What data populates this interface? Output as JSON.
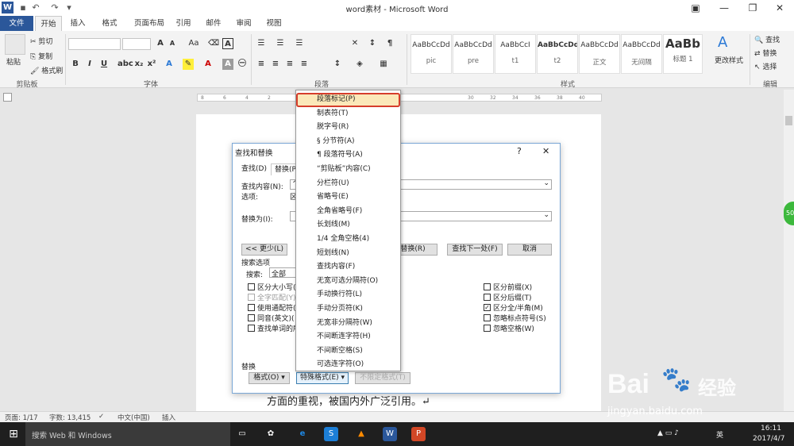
{
  "window": {
    "title": "word素材 - Microsoft Word"
  },
  "tabs": [
    "文件",
    "开始",
    "插入",
    "格式",
    "页面布局",
    "引用",
    "邮件",
    "审阅",
    "视图"
  ],
  "ribbon": {
    "clipboard": {
      "paste": "粘贴",
      "cut": "剪切",
      "copy": "复制",
      "painter": "格式刷",
      "label": "剪贴板"
    },
    "font": {
      "label": "字体",
      "bold": "B",
      "italic": "I",
      "underline": "U",
      "grow": "A",
      "shrink": "A",
      "aa": "Aa"
    },
    "paragraph": {
      "label": "段落"
    },
    "styles": {
      "label": "样式",
      "items": [
        {
          "sample": "AaBbCcDd",
          "name": "pic"
        },
        {
          "sample": "AaBbCcDd",
          "name": "pre"
        },
        {
          "sample": "AaBbCcI",
          "name": "t1"
        },
        {
          "sample": "AaBbCcDd",
          "name": "t2"
        },
        {
          "sample": "AaBbCcDd",
          "name": "正文"
        },
        {
          "sample": "AaBbCcDd",
          "name": "无间隔"
        },
        {
          "sample": "AaBb",
          "name": "标题 1"
        }
      ],
      "change": "更改样式"
    },
    "editing": {
      "label": "编辑",
      "find": "查找",
      "replace": "替换",
      "select": "选择"
    }
  },
  "ruler": {
    "ticks": [
      "8",
      "6",
      "4",
      "2",
      "",
      "2",
      "",
      "",
      "",
      "",
      "",
      "",
      "30",
      "32",
      "34",
      "36",
      "38",
      "40"
    ]
  },
  "document": {
    "text": "方面的重视，被国内外广泛引用。↵"
  },
  "dialog": {
    "title": "查找和替换",
    "help": "?",
    "close": "✕",
    "tabs": [
      "查找(D)",
      "替换(P)"
    ],
    "find_label": "查找内容(N):",
    "find_value": "^",
    "options_label": "选项:",
    "options_value": "区",
    "replace_label": "替换为(I):",
    "less_button": "<< 更少(L)",
    "replace_button": "替换(R)",
    "find_next_button": "查找下一处(F)",
    "cancel_button": "取消",
    "search_options": "搜索选项",
    "search_label": "搜索:",
    "search_value": "全部",
    "left_checks": [
      {
        "label": "区分大小写(",
        "checked": false,
        "disabled": false
      },
      {
        "label": "全字匹配(Y)",
        "checked": false,
        "disabled": true
      },
      {
        "label": "使用通配符(",
        "checked": false,
        "disabled": false
      },
      {
        "label": "同音(英文)(",
        "checked": false,
        "disabled": false
      },
      {
        "label": "查找单词的所",
        "checked": false,
        "disabled": false
      }
    ],
    "right_checks": [
      {
        "label": "区分前缀(X)",
        "checked": false
      },
      {
        "label": "区分后缀(T)",
        "checked": false
      },
      {
        "label": "区分全/半角(M)",
        "checked": true
      },
      {
        "label": "忽略标点符号(S)",
        "checked": false
      },
      {
        "label": "忽略空格(W)",
        "checked": false
      }
    ],
    "replace_section": "替换",
    "format_button": "格式(O) ▾",
    "special_button": "特殊格式(E) ▾",
    "noformat_button": "不限定格式(T)"
  },
  "special_menu": [
    "段落标记(P)",
    "制表符(T)",
    "脱字号(R)",
    "§ 分节符(A)",
    "¶ 段落符号(A)",
    "“剪贴板”内容(C)",
    "分栏符(U)",
    "省略号(E)",
    "全角省略号(F)",
    "长划线(M)",
    "1/4 全角空格(4)",
    "短划线(N)",
    "查找内容(F)",
    "无宽可选分隔符(O)",
    "手动换行符(L)",
    "手动分页符(K)",
    "无宽非分隔符(W)",
    "不间断连字符(H)",
    "不间断空格(S)",
    "可选连字符(O)"
  ],
  "status": {
    "page": "页面: 1/17",
    "words": "字数: 13,415",
    "lang": "中文(中国)",
    "insert": "插入"
  },
  "taskbar": {
    "search": "搜索 Web 和 Windows",
    "time": "16:11",
    "date": "2017/4/7",
    "ime": "英"
  },
  "watermark": {
    "brand": "Bai",
    "brand2": "经验",
    "url": "jingyan.baidu.com"
  },
  "sidebar_ball": "50"
}
